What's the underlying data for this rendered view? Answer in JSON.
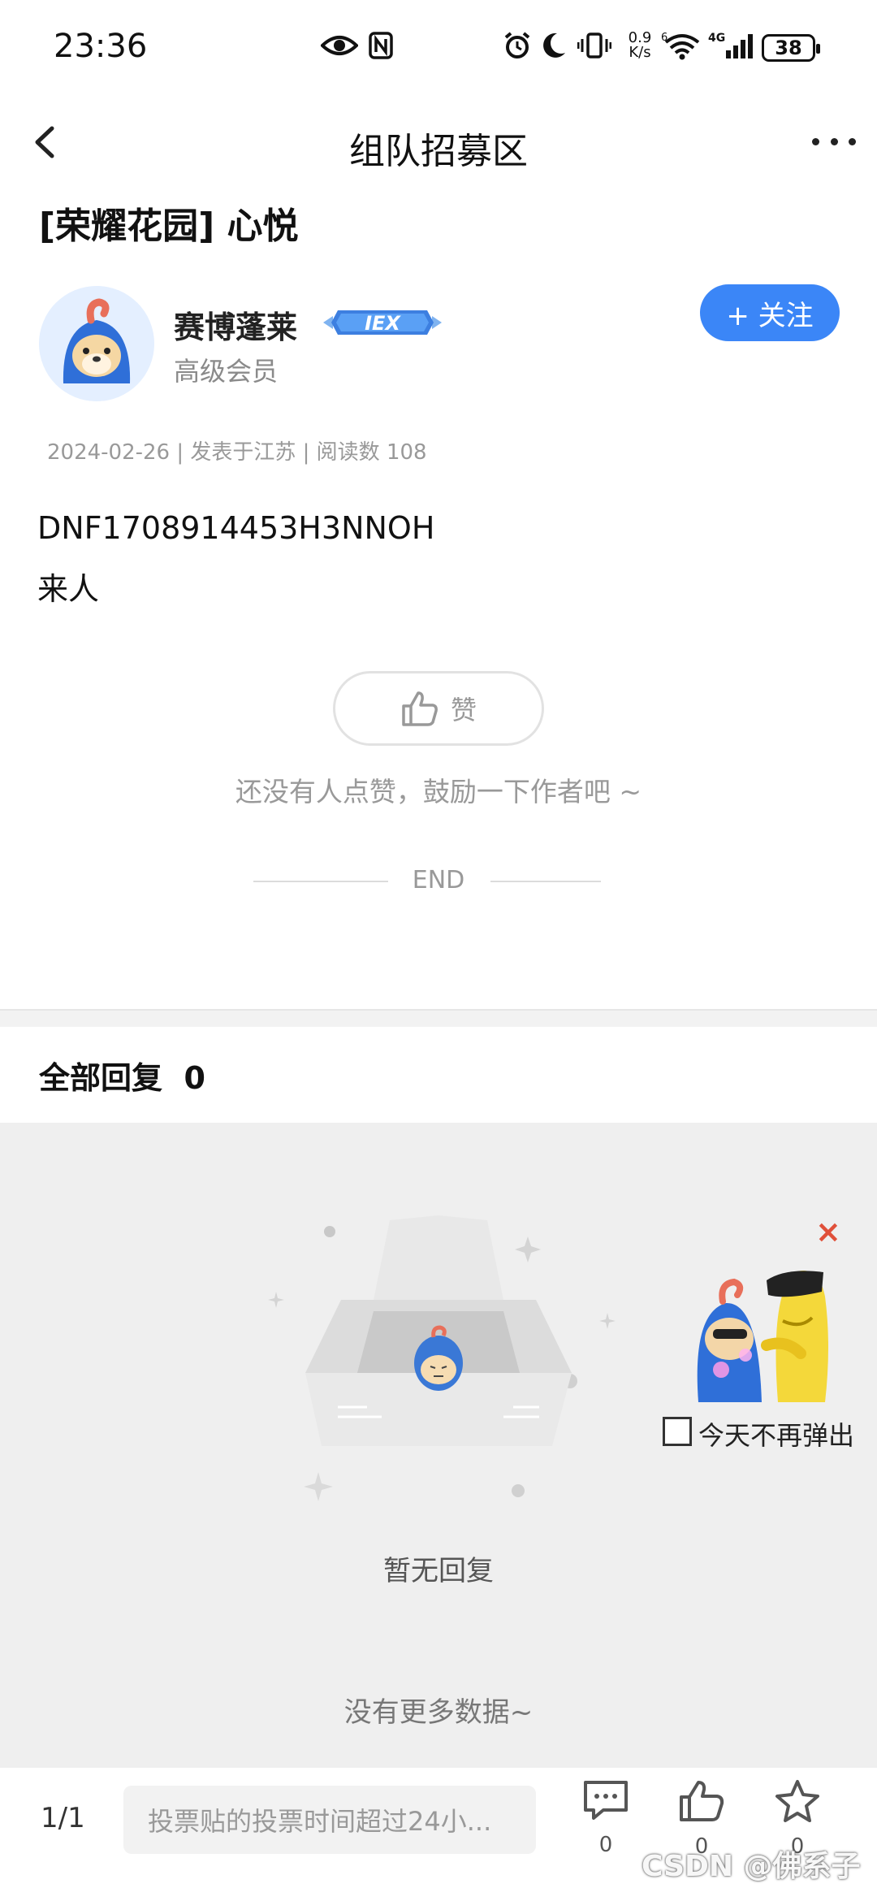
{
  "status_bar": {
    "time": "23:36",
    "net_speed_value": "0.9",
    "net_speed_unit": "K/s",
    "signal_label": "4G",
    "wifi_label": "6",
    "battery": "38"
  },
  "nav": {
    "title": "组队招募区"
  },
  "post": {
    "title": "[荣耀花园] 心悦",
    "author_name": "赛博蓬莱",
    "author_badge": "IEX",
    "author_level": "高级会员",
    "follow_label": "+ 关注",
    "meta": "2024-02-26 | 发表于江苏 | 阅读数 108",
    "body_line1": "DNF1708914453H3NNOH",
    "body_line2": "来人",
    "like_label": "赞",
    "like_hint": "还没有人点赞，鼓励一下作者吧 ~",
    "end_label": "END"
  },
  "replies": {
    "title": "全部回复",
    "count": "0",
    "empty_text": "暂无回复",
    "no_more_text": "没有更多数据~"
  },
  "popup": {
    "close_label": "×",
    "checkbox_label": "今天不再弹出"
  },
  "bottom_bar": {
    "page_indicator": "1/1",
    "input_placeholder": "投票贴的投票时间超过24小...",
    "comment_count": "0",
    "like_count": "0",
    "favorite_count": "0"
  },
  "watermark": "CSDN @佛系子",
  "colors": {
    "accent": "#3b86f7",
    "close": "#e0503a"
  }
}
